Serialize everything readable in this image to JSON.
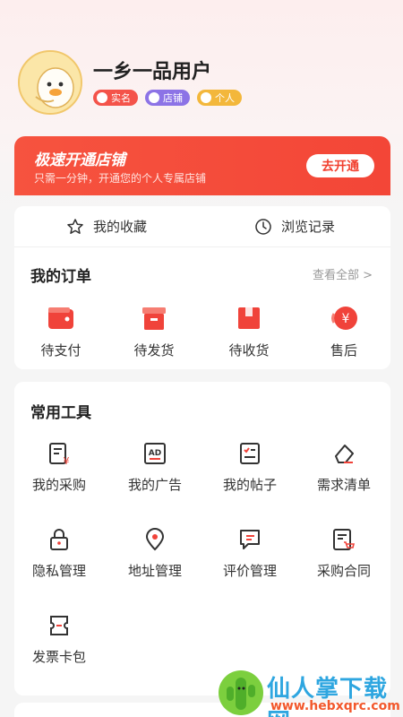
{
  "profile": {
    "username": "一乡一品用户",
    "badges": [
      "实名",
      "店铺",
      "个人"
    ]
  },
  "promo": {
    "title": "极速开通店铺",
    "subtitle": "只需一分钟，开通您的个人专属店铺",
    "button": "去开通"
  },
  "quick": {
    "favorites": "我的收藏",
    "history": "浏览记录"
  },
  "orders": {
    "title": "我的订单",
    "view_all": "查看全部 >",
    "items": [
      "待支付",
      "待发货",
      "待收货",
      "售后"
    ]
  },
  "tools": {
    "title": "常用工具",
    "items": [
      "我的采购",
      "我的广告",
      "我的帖子",
      "需求清单",
      "隐私管理",
      "地址管理",
      "评价管理",
      "采购合同",
      "发票卡包"
    ]
  },
  "watermark": {
    "title": "仙人掌下载网",
    "url": "www.hebxqrc.com"
  },
  "colors": {
    "accent": "#f34637",
    "icon_stroke": "#333333"
  }
}
